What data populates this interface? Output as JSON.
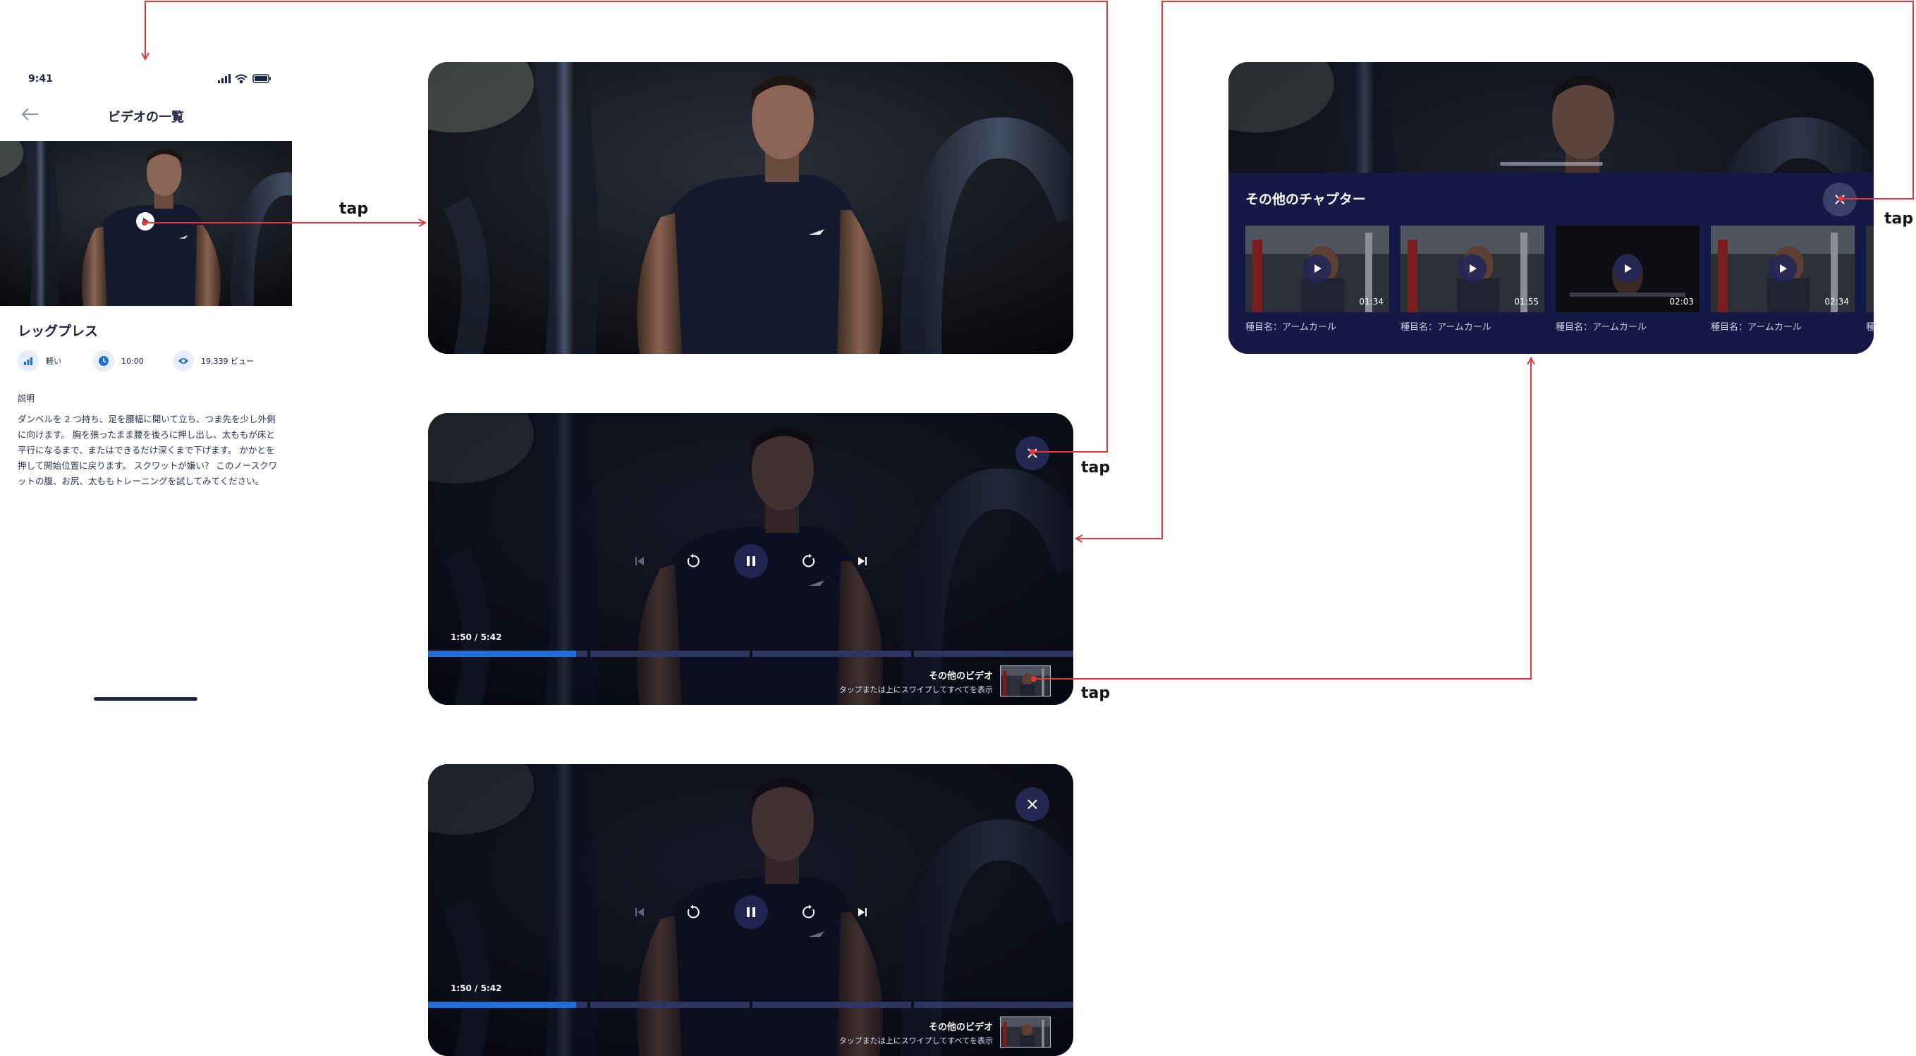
{
  "colors": {
    "accent": "#1e6fd9",
    "navy": "#1d2340",
    "panel": "#141a45",
    "arrow": "#e0383e",
    "progress_track": "#2e3560"
  },
  "phone": {
    "status_time": "9:41",
    "status_icons": [
      "signal-icon",
      "wifi-icon",
      "battery-icon"
    ],
    "nav_title": "ビデオの一覧",
    "exercise_title": "レッグプレス",
    "meta": [
      {
        "icon": "intensity-icon",
        "label": "軽い"
      },
      {
        "icon": "clock-icon",
        "label": "10:00"
      },
      {
        "icon": "eye-icon",
        "label": "19,339 ビュー"
      }
    ],
    "description_label": "説明",
    "description": "ダンベルを 2 つ持ち、足を腰幅に開いて立ち、つま先を少し外側に向けます。 胸を張ったまま腰を後ろに押し出し、太ももが床と平行になるまで、またはできるだけ深くまで下げます。 かかとを押して開始位置に戻ります。 スクワットが嫌い？ このノースクワットの腹、お尻、太ももトレーニングを試してみてください。"
  },
  "player": {
    "time": "1:50 / 5:42",
    "progress": 0.23,
    "segments": 4,
    "more_videos_title": "その他のビデオ",
    "more_videos_hint": "タップまたは上にスワイプしてすべてを表示"
  },
  "chapters": {
    "title": "その他のチャプター",
    "items": [
      {
        "duration": "01:34",
        "name": "種目名：アームカール"
      },
      {
        "duration": "01:55",
        "name": "種目名：アームカール"
      },
      {
        "duration": "02:03",
        "name": "種目名：アームカール"
      },
      {
        "duration": "02:34",
        "name": "種目名：アームカール"
      }
    ],
    "partial_name": "種"
  },
  "annotations": {
    "tap_label": "tap"
  }
}
